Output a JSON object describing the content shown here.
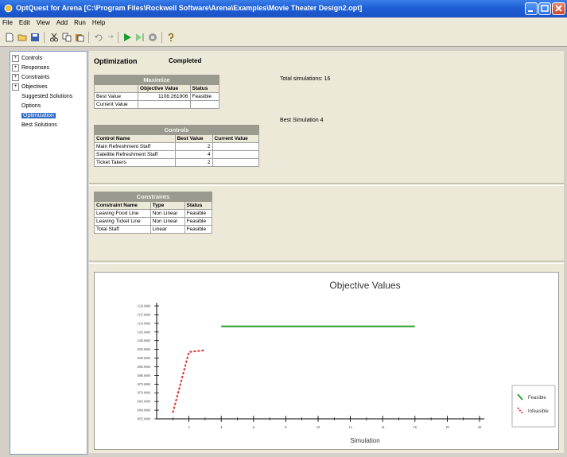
{
  "window": {
    "title": "OptQuest for Arena  [C:\\Program Files\\Rockwell Software\\Arena\\Examples\\Movie Theater Design2.opt]"
  },
  "menu": [
    "File",
    "Edit",
    "View",
    "Add",
    "Run",
    "Help"
  ],
  "toolbar_icons": [
    "new-icon",
    "open-icon",
    "save-icon",
    "cut-icon",
    "copy-icon",
    "paste-icon",
    "undo-icon",
    "redo-icon",
    "run-icon",
    "step-icon",
    "stop-icon",
    "help-icon"
  ],
  "tree": [
    {
      "label": "Controls",
      "expandable": true,
      "indent": 0
    },
    {
      "label": "Responses",
      "expandable": true,
      "indent": 0
    },
    {
      "label": "Constraints",
      "expandable": true,
      "indent": 0
    },
    {
      "label": "Objectives",
      "expandable": true,
      "indent": 0
    },
    {
      "label": "Suggested Solutions",
      "expandable": false,
      "indent": 1
    },
    {
      "label": "Options",
      "expandable": false,
      "indent": 1
    },
    {
      "label": "Optimization",
      "expandable": false,
      "indent": 1,
      "selected": true
    },
    {
      "label": "Best Solutions",
      "expandable": false,
      "indent": 1
    }
  ],
  "header": {
    "optimization_label": "Optimization",
    "status": "Completed"
  },
  "summary": {
    "total_simulations": "Total simulations: 16",
    "best_simulation": "Best Simulation 4"
  },
  "maximize_table": {
    "caption": "Maximize",
    "columns": [
      "",
      "Objective Value",
      "Status"
    ],
    "rows": [
      [
        "Best Value",
        "1108.261906",
        "Feasible"
      ],
      [
        "Current Value",
        "",
        ""
      ]
    ]
  },
  "controls_table": {
    "caption": "Controls",
    "columns": [
      "Control Name",
      "Best Value",
      "Current Value"
    ],
    "rows": [
      [
        "Main Refreshment Staff",
        "2",
        ""
      ],
      [
        "Satellite Refreshment Staff",
        "4",
        ""
      ],
      [
        "Ticket Takers",
        "2",
        ""
      ]
    ]
  },
  "constraints_table": {
    "caption": "Constraints",
    "columns": [
      "Constraint Name",
      "Type",
      "Status"
    ],
    "rows": [
      [
        "Leaving Food Line",
        "Non Linear",
        "Feasible"
      ],
      [
        "Leaving Ticket Line",
        "Non Linear",
        "Feasible"
      ],
      [
        "Total Staff",
        "Linear",
        "Feasible"
      ]
    ]
  },
  "chart_data": {
    "type": "line",
    "title": "Objective Values",
    "xlabel": "Simulation",
    "ylabel": "",
    "xlim": [
      0,
      20
    ],
    "ylim": [
      1055,
      1120
    ],
    "x_ticks": [
      2,
      4,
      6,
      8,
      10,
      12,
      14,
      16,
      18,
      20
    ],
    "y_tick_labels": [
      "1120.0000",
      "1115.0000",
      "1110.0000",
      "1105.0000",
      "1100.0000",
      "1095.0000",
      "1090.0000",
      "1085.0000",
      "1080.0000",
      "1075.0000",
      "1070.0000",
      "1065.0000",
      "1060.0000",
      "1055.0000"
    ],
    "legend_position": "right",
    "series": [
      {
        "name": "Feasible",
        "color": "#2e9e2e",
        "dashed": false,
        "x": [
          4,
          16
        ],
        "y": [
          1108.26,
          1108.26
        ]
      },
      {
        "name": "Infeasible",
        "color": "#e03030",
        "dashed": true,
        "x": [
          1,
          2,
          3
        ],
        "y": [
          1058.5,
          1093.5,
          1094.5
        ]
      }
    ]
  }
}
